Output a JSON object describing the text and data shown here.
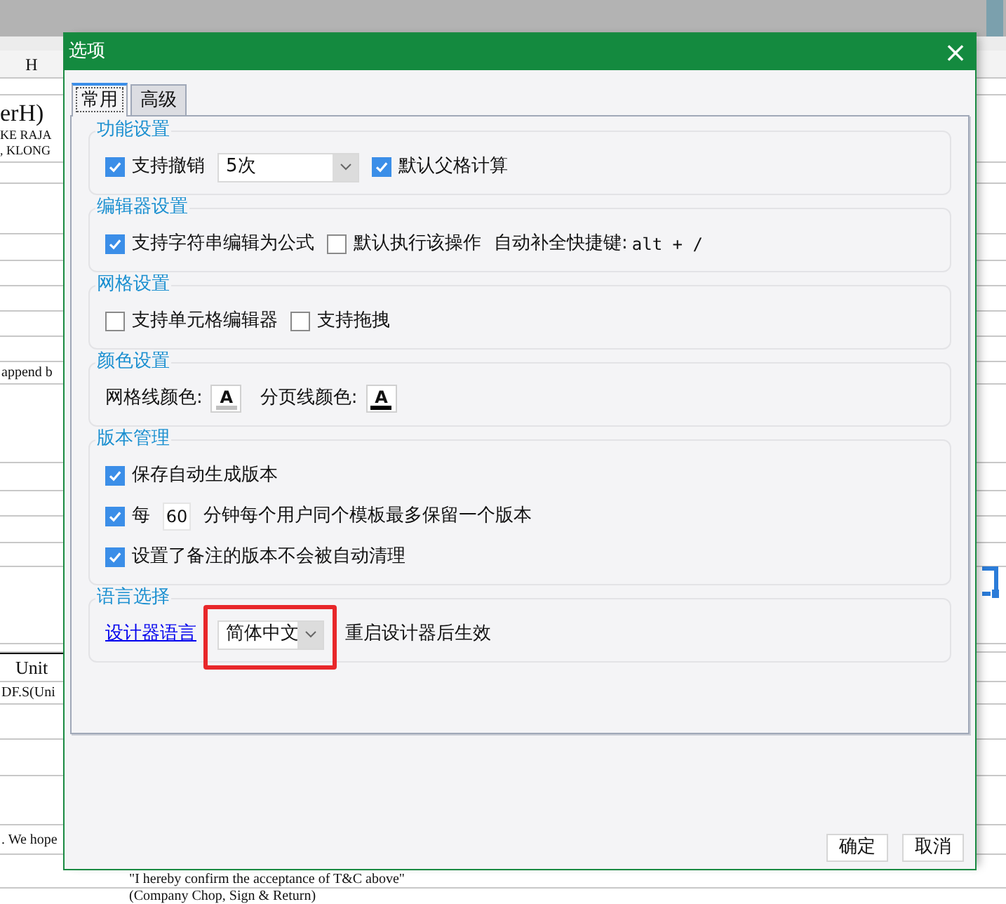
{
  "sheet": {
    "column_header": "H",
    "cells": [
      "erH)",
      "KE RAJA",
      ", KLONG",
      "append b",
      "Unit",
      "DF.S(Uni",
      ". We hope",
      "\"I hereby confirm the acceptance of T&C above\"",
      "(Company Chop, Sign & Return)"
    ]
  },
  "dialog": {
    "title": "选项",
    "close": "×",
    "tabs": [
      {
        "label": "常用",
        "selected": true
      },
      {
        "label": "高级",
        "selected": false
      }
    ],
    "groups": [
      {
        "title": "功能设置",
        "rows": [
          [
            {
              "kind": "checkbox",
              "label": "支持撤销",
              "checked": true
            },
            {
              "kind": "select",
              "value": "5次",
              "highlighted": false
            },
            {
              "kind": "checkbox",
              "label": "默认父格计算",
              "checked": true
            }
          ]
        ]
      },
      {
        "title": "编辑器设置",
        "rows": [
          [
            {
              "kind": "checkbox",
              "label": "支持字符串编辑为公式",
              "checked": true
            },
            {
              "kind": "checkbox",
              "label": "默认执行该操作",
              "checked": false
            },
            {
              "kind": "text",
              "text": "自动补全快捷键:"
            },
            {
              "kind": "code",
              "text": "alt + /"
            }
          ]
        ]
      },
      {
        "title": "网格设置",
        "rows": [
          [
            {
              "kind": "checkbox",
              "label": "支持单元格编辑器",
              "checked": false
            },
            {
              "kind": "checkbox",
              "label": "支持拖拽",
              "checked": false
            }
          ]
        ]
      },
      {
        "title": "颜色设置",
        "rows": [
          [
            {
              "kind": "color",
              "label": "网格线颜色:",
              "glyph": "A",
              "color": "#c0c0c0"
            },
            {
              "kind": "color",
              "label": "分页线颜色:",
              "glyph": "A",
              "color": "#000000"
            }
          ]
        ]
      },
      {
        "title": "版本管理",
        "rows": [
          [
            {
              "kind": "checkbox",
              "label": "保存自动生成版本",
              "checked": true
            }
          ],
          [
            {
              "kind": "checkbox",
              "label": "每",
              "checked": true
            },
            {
              "kind": "number",
              "value": "60"
            },
            {
              "kind": "text",
              "text": "分钟每个用户同个模板最多保留一个版本"
            }
          ],
          [
            {
              "kind": "checkbox",
              "label": "设置了备注的版本不会被自动清理",
              "checked": true
            }
          ]
        ]
      },
      {
        "title": "语言选择",
        "rows": [
          [
            {
              "kind": "link",
              "text": "设计器语言"
            },
            {
              "kind": "select",
              "value": "简体中文",
              "highlighted": true
            },
            {
              "kind": "text",
              "text": "重启设计器后生效"
            }
          ]
        ]
      }
    ],
    "buttons": [
      "确定",
      "取消"
    ]
  }
}
